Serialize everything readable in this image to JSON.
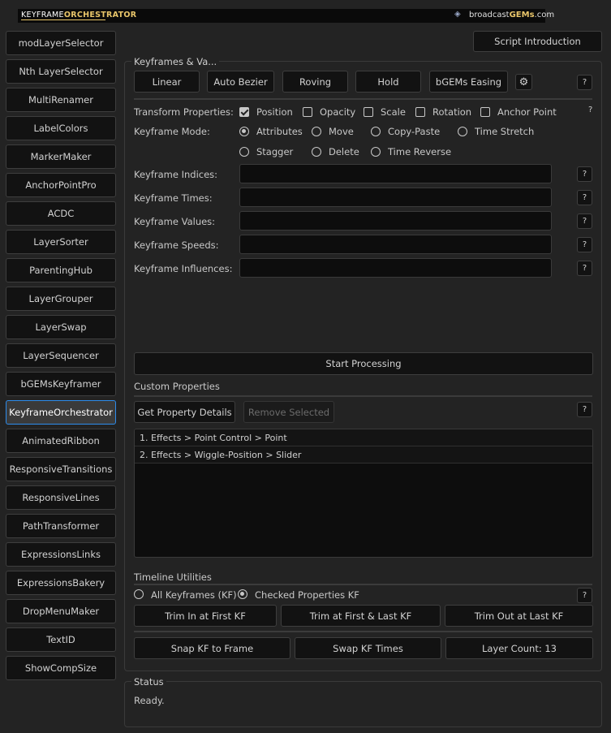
{
  "banner": {
    "title_plain": "KEYFRAME",
    "title_bold": "ORCHESTRATOR",
    "brand_plain": "broadcast",
    "brand_bold": "GEMs",
    "brand_suffix": ".com"
  },
  "sidebar": {
    "items": [
      {
        "label": "modLayerSelector"
      },
      {
        "label": "Nth LayerSelector"
      },
      {
        "label": "MultiRenamer"
      },
      {
        "label": "LabelColors"
      },
      {
        "label": "MarkerMaker"
      },
      {
        "label": "AnchorPointPro"
      },
      {
        "label": "ACDC"
      },
      {
        "label": "LayerSorter"
      },
      {
        "label": "ParentingHub"
      },
      {
        "label": "LayerGrouper"
      },
      {
        "label": "LayerSwap"
      },
      {
        "label": "LayerSequencer"
      },
      {
        "label": "bGEMsKeyframer"
      },
      {
        "label": "KeyframeOrchestrator"
      },
      {
        "label": "AnimatedRibbon"
      },
      {
        "label": "ResponsiveTransitions"
      },
      {
        "label": "ResponsiveLines"
      },
      {
        "label": "PathTransformer"
      },
      {
        "label": "ExpressionsLinks"
      },
      {
        "label": "ExpressionsBakery"
      },
      {
        "label": "DropMenuMaker"
      },
      {
        "label": "TextID"
      },
      {
        "label": "ShowCompSize"
      }
    ],
    "active_index": 13
  },
  "header": {
    "script_intro": "Script Introduction"
  },
  "keyframes": {
    "title": "Keyframes & Va...",
    "easing": [
      "Linear",
      "Auto Bezier",
      "Roving",
      "Hold",
      "bGEMs Easing"
    ],
    "help": "?",
    "transform_label": "Transform Properties:",
    "transform_props": [
      {
        "label": "Position",
        "checked": true
      },
      {
        "label": "Opacity",
        "checked": false
      },
      {
        "label": "Scale",
        "checked": false
      },
      {
        "label": "Rotation",
        "checked": false
      },
      {
        "label": "Anchor Point",
        "checked": false
      }
    ],
    "mode_label": "Keyframe Mode:",
    "modes": [
      {
        "label": "Attributes",
        "selected": true
      },
      {
        "label": "Move",
        "selected": false
      },
      {
        "label": "Copy-Paste",
        "selected": false
      },
      {
        "label": "Time Stretch",
        "selected": false
      },
      {
        "label": "Stagger",
        "selected": false
      },
      {
        "label": "Delete",
        "selected": false
      },
      {
        "label": "Time Reverse",
        "selected": false
      }
    ],
    "fields": [
      {
        "label": "Keyframe Indices:",
        "value": ""
      },
      {
        "label": "Keyframe Times:",
        "value": ""
      },
      {
        "label": "Keyframe Values:",
        "value": ""
      },
      {
        "label": "Keyframe Speeds:",
        "value": ""
      },
      {
        "label": "Keyframe Influences:",
        "value": ""
      }
    ],
    "start": "Start Processing"
  },
  "custom": {
    "title": "Custom Properties",
    "get_details": "Get Property Details",
    "remove_selected": "Remove Selected",
    "items": [
      "1. Effects > Point Control > Point",
      "2. Effects > Wiggle-Position > Slider"
    ]
  },
  "timeline": {
    "title": "Timeline Utilities",
    "scope": [
      {
        "label": "All Keyframes (KF)",
        "selected": false
      },
      {
        "label": "Checked Properties KF",
        "selected": true
      }
    ],
    "trim_in": "Trim In at First KF",
    "trim_both": "Trim at First & Last KF",
    "trim_out": "Trim Out at Last KF",
    "snap": "Snap KF to Frame",
    "swap": "Swap KF Times",
    "layer_count": "Layer Count: 13"
  },
  "status": {
    "title": "Status",
    "text": "Ready."
  },
  "colors": {
    "accent": "#2d8ceb",
    "banner_gold": "#e8c56a",
    "background": "#232323"
  }
}
